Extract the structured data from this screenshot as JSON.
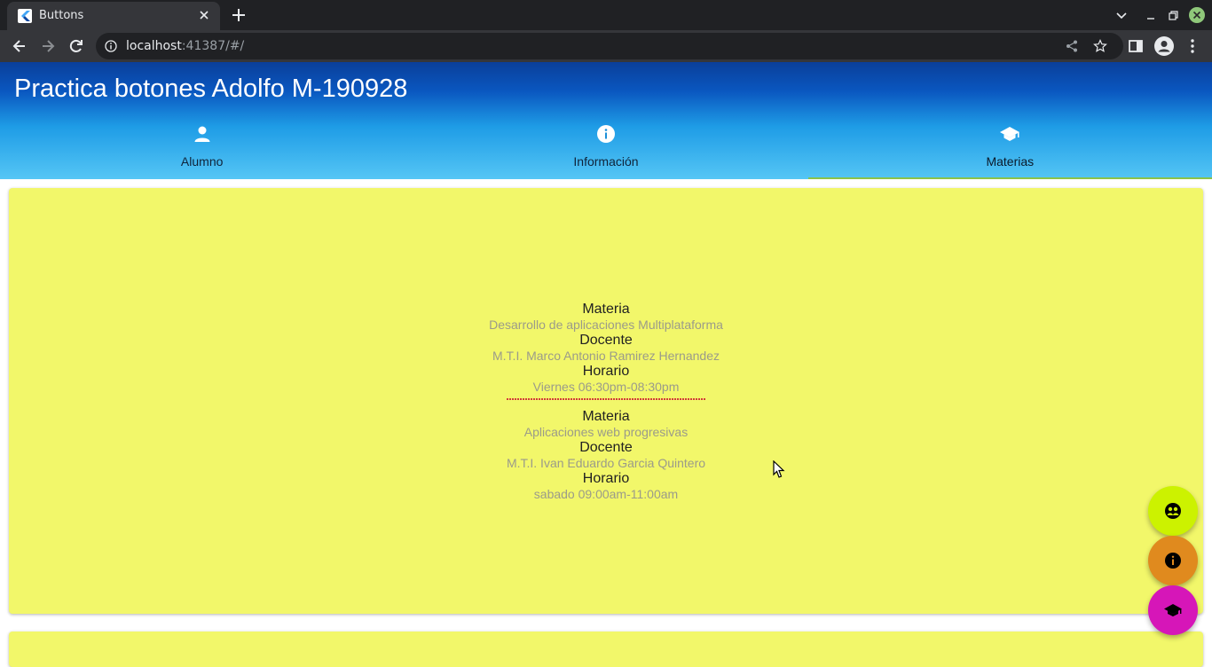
{
  "browser": {
    "tab_title": "Buttons",
    "url_host": "localhost",
    "url_rest": ":41387/#/"
  },
  "app": {
    "title": "Practica botones Adolfo M-190928",
    "tabs": [
      {
        "label": "Alumno",
        "icon": "person-icon"
      },
      {
        "label": "Información",
        "icon": "info-icon"
      },
      {
        "label": "Materias",
        "icon": "school-icon",
        "active": true
      }
    ]
  },
  "materias": [
    {
      "materia_label": "Materia",
      "materia": "Desarrollo de aplicaciones Multiplataforma",
      "docente_label": "Docente",
      "docente": "M.T.I. Marco Antonio Ramirez Hernandez",
      "horario_label": "Horario",
      "horario": "Viernes 06:30pm-08:30pm"
    },
    {
      "materia_label": "Materia",
      "materia": "Aplicaciones web progresivas",
      "docente_label": "Docente",
      "docente": "M.T.I. Ivan Eduardo Garcia Quintero",
      "horario_label": "Horario",
      "horario": "sabado 09:00am-11:00am"
    }
  ],
  "fabs": [
    {
      "icon": "group-icon",
      "color": "#ccf200"
    },
    {
      "icon": "info-icon",
      "color": "#e08a1e"
    },
    {
      "icon": "school-icon",
      "color": "#d616b8"
    }
  ],
  "colors": {
    "card": "#f2f76a",
    "appbar_top": "#0a3f9a",
    "appbar_bottom": "#55c6f5",
    "tab_indicator": "#8bc34a"
  }
}
